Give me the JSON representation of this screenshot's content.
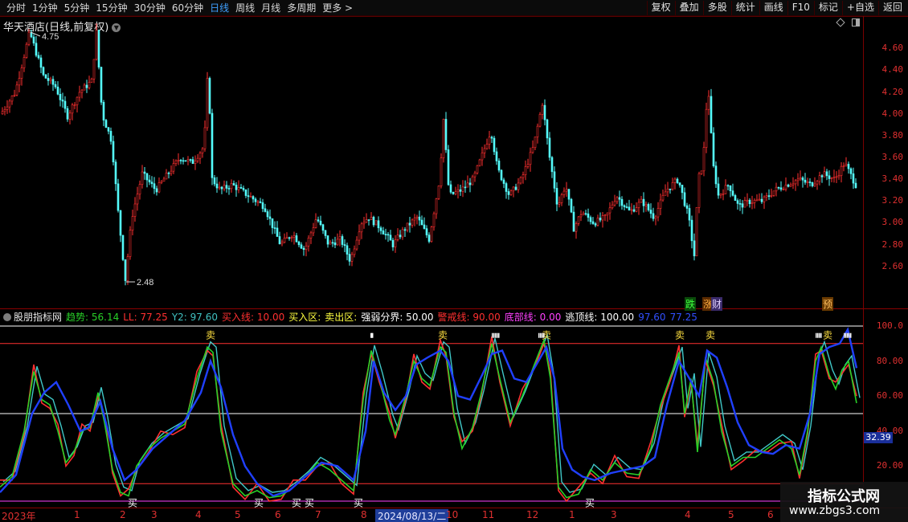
{
  "toolbar": {
    "periods": [
      "分时",
      "1分钟",
      "5分钟",
      "15分钟",
      "30分钟",
      "60分钟",
      "日线",
      "周线",
      "月线",
      "多周期",
      "更多 >"
    ],
    "active_period": "日线",
    "tools": [
      "复权",
      "叠加",
      "多股",
      "统计",
      "画线",
      "F10",
      "标记",
      "+自选",
      "返回"
    ]
  },
  "kline_panel": {
    "title": "华天酒店(日线,前复权)",
    "high_label": "4.75",
    "low_label": "2.48",
    "price_scale": [
      "4.60",
      "4.40",
      "4.20",
      "4.00",
      "3.80",
      "3.60",
      "3.40",
      "3.20",
      "3.00",
      "2.80",
      "2.60"
    ],
    "badges": [
      "跌",
      "涨",
      "财",
      "预"
    ]
  },
  "indicator_panel": {
    "name": "股朋指标网",
    "items": [
      {
        "label": "趋势: 56.14",
        "color": "#28d028"
      },
      {
        "label": "LL: 77.25",
        "color": "#ff3030"
      },
      {
        "label": "Y2: 97.60",
        "color": "#40c0c0"
      },
      {
        "label": "买入线: 10.00",
        "color": "#ff3030"
      },
      {
        "label": "买入区:",
        "color": "#ffff40"
      },
      {
        "label": "卖出区:",
        "color": "#ffff40"
      },
      {
        "label": "强弱分界: 50.00",
        "color": "#ffffff"
      },
      {
        "label": "警戒线: 90.00",
        "color": "#ff3030"
      },
      {
        "label": "底部线: 0.00",
        "color": "#ff40ff"
      },
      {
        "label": "逃顶线: 100.00",
        "color": "#ffffff"
      },
      {
        "label": "97.60",
        "color": "#3050ff"
      },
      {
        "label": "77.25",
        "color": "#3050ff"
      }
    ],
    "scale": [
      "100.0",
      "80.00",
      "60.00",
      "40.00",
      "20.00"
    ],
    "current_value": "32.39",
    "sell_marker": "卖",
    "buy_marker": "买"
  },
  "xaxis": {
    "labels": [
      "2023年",
      "1",
      "2",
      "3",
      "4",
      "5",
      "6",
      "7",
      "8",
      "10",
      "11",
      "12",
      "1",
      "3",
      "4",
      "5",
      "6"
    ],
    "selected_date": "2024/08/13/二"
  },
  "watermark": {
    "line1": "指标公式网",
    "line2": "www.zbgs3.com"
  }
}
